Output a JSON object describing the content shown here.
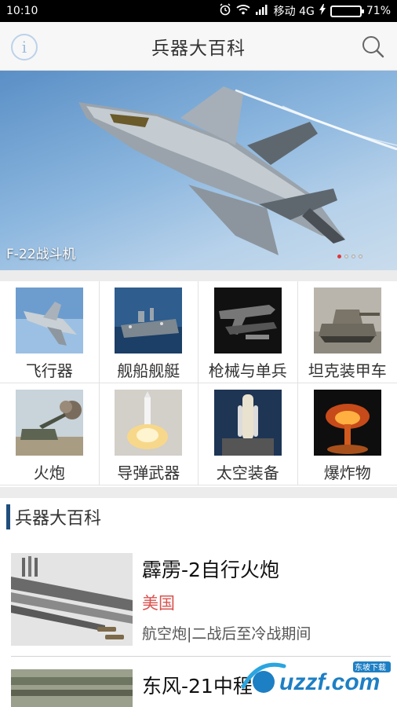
{
  "status_bar": {
    "time": "10:10",
    "carrier": "移动 4G",
    "battery": "71%",
    "battery_level": 0.71
  },
  "header": {
    "title": "兵器大百科",
    "info_icon": "info-icon",
    "search_icon": "search-icon"
  },
  "banner": {
    "caption": "F-22战斗机",
    "page_count": 4,
    "active_page": 1
  },
  "categories": [
    {
      "label": "飞行器"
    },
    {
      "label": "舰船舰艇"
    },
    {
      "label": "枪械与单兵"
    },
    {
      "label": "坦克装甲车"
    },
    {
      "label": "火炮"
    },
    {
      "label": "导弹武器"
    },
    {
      "label": "太空装备"
    },
    {
      "label": "爆炸物"
    }
  ],
  "section": {
    "title": "兵器大百科",
    "accent_color": "#1f4e7d"
  },
  "articles": [
    {
      "name": "霹雳-2自行火炮",
      "country": "美国",
      "tags": "航空炮|二战后至冷战期间"
    },
    {
      "name": "东风-21中程",
      "country": "",
      "tags": ""
    }
  ],
  "watermark": {
    "brand": "uzzf.com",
    "tagline": "东坡下载"
  },
  "colors": {
    "country_text": "#d9534f",
    "battery_fill": "#3ad13a"
  }
}
